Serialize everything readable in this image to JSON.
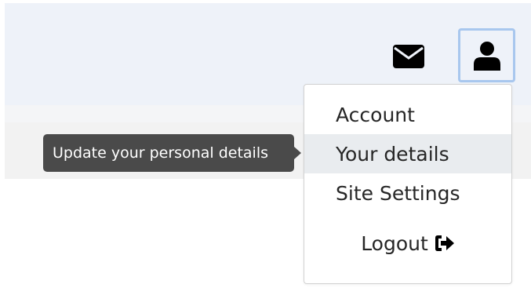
{
  "header": {
    "mail_icon": "envelope-icon",
    "user_icon": "user-icon"
  },
  "dropdown": {
    "items": [
      {
        "label": "Account"
      },
      {
        "label": "Your details",
        "active": true
      },
      {
        "label": "Site Settings"
      }
    ],
    "logout_label": "Logout",
    "logout_icon": "sign-out-icon"
  },
  "tooltip": {
    "text": "Update your personal details"
  },
  "colors": {
    "header_bg": "#eef2f9",
    "focus_ring": "#a8c7ee",
    "tooltip_bg": "#4a4a4a",
    "active_item_bg": "#e9ecef"
  }
}
